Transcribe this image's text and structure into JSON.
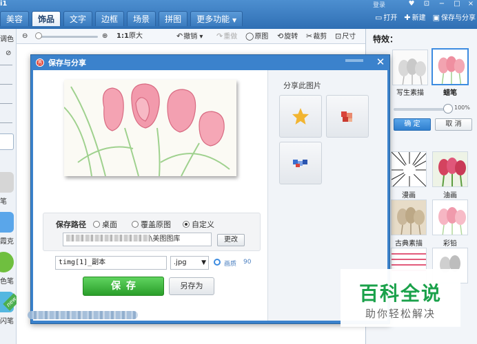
{
  "window": {
    "title_fragment": "i1",
    "login": "登录",
    "controls": [
      "♥",
      "⊡",
      "−",
      "□",
      "×"
    ]
  },
  "tabs": [
    {
      "label": "美容",
      "active": false
    },
    {
      "label": "饰品",
      "active": true
    },
    {
      "label": "文字",
      "active": false
    },
    {
      "label": "边框",
      "active": false
    },
    {
      "label": "场景",
      "active": false
    },
    {
      "label": "拼图",
      "active": false
    },
    {
      "label": "更多功能",
      "active": false
    }
  ],
  "top_tools": {
    "open": "打开",
    "new": "新建",
    "save_share": "保存与分享"
  },
  "toolbar": {
    "zoom_ratio": "1:1",
    "original_size": "原大",
    "undo": "撤销",
    "redo": "重做",
    "original": "原图",
    "rotate": "旋转",
    "crop": "裁剪",
    "size": "尺寸"
  },
  "left_panel": {
    "adjust_label": "调色",
    "tools": [
      {
        "label": "笔",
        "icon": "pen-icon",
        "color": "#d6d6d6"
      },
      {
        "label": "霞克",
        "icon": "mosaic-icon",
        "color": "#5aa6ea"
      },
      {
        "label": "色笔",
        "icon": "color-pen-icon",
        "color": "#6fbf3f"
      },
      {
        "label": "闪笔",
        "icon": "sparkle-pen-icon",
        "color": "#54b7e0"
      }
    ],
    "new_badge": "new"
  },
  "dialog": {
    "title": "保存与分享",
    "logo_text": "秀",
    "path": {
      "label": "保存路径",
      "options": [
        {
          "label": "桌面",
          "selected": false
        },
        {
          "label": "覆盖原图",
          "selected": false
        },
        {
          "label": "自定义",
          "selected": true
        }
      ],
      "value_suffix": "\\美图图库",
      "change_button": "更改"
    },
    "filename": "timg[1]_副本",
    "format": ".jpg",
    "quality_label": "画质",
    "quality_value": "90",
    "save_button": "保存",
    "save_as_button": "另存为",
    "share": {
      "title": "分享此图片",
      "targets": [
        {
          "icon": "star-share-icon",
          "color": "#f2b531"
        },
        {
          "icon": "weibo-share-icon",
          "color": "#d9443b"
        },
        {
          "icon": "qzone-share-icon",
          "color": "#3a6fd0"
        }
      ]
    }
  },
  "right_panel": {
    "title": "特效：",
    "effects_top": [
      {
        "label": "写生素描",
        "selected": false
      },
      {
        "label": "蜡笔",
        "selected": true
      }
    ],
    "intensity_percent": 100,
    "intensity_label": "100%",
    "ok": "确 定",
    "cancel": "取 消",
    "effects": [
      {
        "label": "漫画"
      },
      {
        "label": "油画"
      },
      {
        "label": "古典素描"
      },
      {
        "label": "彩铅"
      }
    ]
  },
  "watermark": {
    "main": "百科全说",
    "sub": "助你轻松解决"
  },
  "colors": {
    "accent": "#3b82cc",
    "save_green": "#2a9e2a",
    "watermark_green": "#1aa14a"
  }
}
